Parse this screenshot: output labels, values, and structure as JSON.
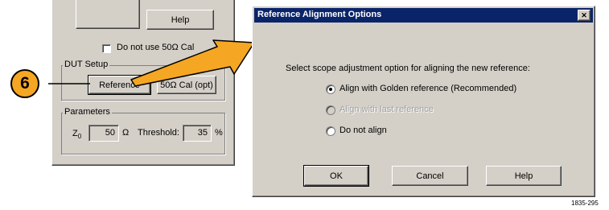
{
  "left_panel": {
    "top_button_label": "",
    "help_button_label": "Help",
    "cal_checkbox_label": "Do not use 50Ω Cal",
    "dut_setup": {
      "group_label": "DUT Setup",
      "reference_button_label": "Reference",
      "cal_button_label": "50Ω Cal (opt)"
    },
    "parameters": {
      "group_label": "Parameters",
      "z0_label": "Z",
      "z0_subscript": "0",
      "z0_value": "50",
      "z0_unit": "Ω",
      "threshold_label": "Threshold:",
      "threshold_value": "35",
      "threshold_unit": "%"
    }
  },
  "callout": {
    "step_number": "6",
    "circle_fill": "#f5a623",
    "arrow_fill": "#f5a623"
  },
  "dialog": {
    "title": "Reference Alignment Options",
    "close_glyph": "✕",
    "title_color": "#0a246a",
    "prompt": "Select scope adjustment option for aligning the new reference:",
    "options": [
      {
        "label": "Align with Golden reference (Recommended)",
        "selected": true,
        "enabled": true
      },
      {
        "label": "Align with last reference",
        "selected": false,
        "enabled": false
      },
      {
        "label": "Do not align",
        "selected": false,
        "enabled": true
      }
    ],
    "buttons": {
      "ok": "OK",
      "cancel": "Cancel",
      "help": "Help"
    }
  },
  "figure_number": "1835-295"
}
